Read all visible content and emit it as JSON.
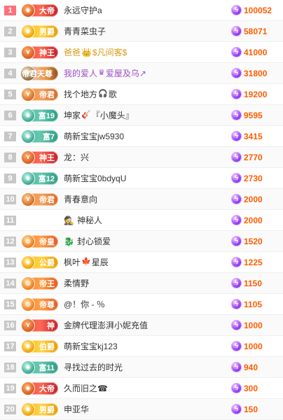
{
  "ranking": {
    "rows": [
      {
        "rank": "1",
        "badge_type": "dadi",
        "badge_label": "大帝",
        "badge_icon": "◉",
        "name": "永远守护a",
        "name_suffix": "",
        "score": "100052"
      },
      {
        "rank": "2",
        "badge_type": "nanjue",
        "badge_label": "男爵",
        "badge_icon": "◉",
        "name": "青青菜虫子",
        "name_suffix": "",
        "score": "58071"
      },
      {
        "rank": "3",
        "badge_type": "shenwang",
        "badge_label": "神王",
        "badge_icon": "⋎",
        "name": "爸爸",
        "name_suffix": "$凡间客$",
        "name_prefix_icon": "👑",
        "score": "41000"
      },
      {
        "rank": "4",
        "badge_type": "dijuntianzun",
        "badge_label": "帝君天尊",
        "badge_icon": "⋎",
        "name": "我的爱人",
        "name_suffix": "爱屋及乌↗",
        "name_prefix_icon": "♛",
        "score": "31800"
      },
      {
        "rank": "5",
        "badge_type": "dijun",
        "badge_label": "帝君",
        "badge_icon": "⋎",
        "name": "找个地方",
        "name_suffix": "歌",
        "name_prefix_icon": "🎧",
        "score": "19200"
      },
      {
        "rank": "6",
        "badge_type": "fu",
        "badge_label": "富19",
        "badge_icon": "◉",
        "name": "坤家",
        "name_suffix": "『小魔头』",
        "name_prefix_icon": "🎸",
        "score": "9595"
      },
      {
        "rank": "7",
        "badge_type": "fu",
        "badge_label": "富7",
        "badge_icon": "◉",
        "name": "萌新宝宝jw5930",
        "name_suffix": "",
        "score": "3415"
      },
      {
        "rank": "8",
        "badge_type": "shenwang",
        "badge_label": "神王",
        "badge_icon": "⋎",
        "name": "龙：兴",
        "name_suffix": "",
        "score": "2770"
      },
      {
        "rank": "9",
        "badge_type": "fu",
        "badge_label": "富12",
        "badge_icon": "◉",
        "name": "萌新宝宝0bdyqU",
        "name_suffix": "",
        "score": "2730"
      },
      {
        "rank": "10",
        "badge_type": "dijun",
        "badge_label": "帝君",
        "badge_icon": "⋎",
        "name": "青春意向",
        "name_suffix": "",
        "score": "2000"
      },
      {
        "rank": "11",
        "badge_type": "",
        "badge_label": "",
        "badge_icon": "",
        "name": "神秘人",
        "name_suffix": "",
        "name_prefix_icon": "🕵",
        "score": "2000"
      },
      {
        "rank": "12",
        "badge_type": "dihuang",
        "badge_label": "帝皇",
        "badge_icon": "◍",
        "name": "封心",
        "name_suffix": "锁爱",
        "name_prefix_icon": "🐉",
        "score": "1520"
      },
      {
        "rank": "13",
        "badge_type": "gongjue",
        "badge_label": "公爵",
        "badge_icon": "◉",
        "name": "枫叶",
        "name_suffix": "星辰",
        "name_prefix_icon": "🍁",
        "score": "1225"
      },
      {
        "rank": "14",
        "badge_type": "dizhi",
        "badge_label": "帝王",
        "badge_icon": "◍",
        "name": "柔情野",
        "name_suffix": "",
        "score": "1150"
      },
      {
        "rank": "15",
        "badge_type": "dizun",
        "badge_label": "帝尊",
        "badge_icon": "◍",
        "name": "@！你 - ％",
        "name_suffix": "",
        "score": "1105"
      },
      {
        "rank": "16",
        "badge_type": "shen",
        "badge_label": "神",
        "badge_icon": "⋎",
        "name": "金牌代理澎湃小妮充值",
        "name_suffix": "",
        "score": "1000"
      },
      {
        "rank": "17",
        "badge_type": "bojue",
        "badge_label": "伯爵",
        "badge_icon": "◉",
        "name": "萌新宝宝kj123",
        "name_suffix": "",
        "score": "1000"
      },
      {
        "rank": "18",
        "badge_type": "fu",
        "badge_label": "富11",
        "badge_icon": "◉",
        "name": "寻找过去的时光",
        "name_suffix": "",
        "score": "940"
      },
      {
        "rank": "19",
        "badge_type": "dadi",
        "badge_label": "大帝",
        "badge_icon": "◉",
        "name": "久而旧之",
        "name_suffix": "☎",
        "score": "300"
      },
      {
        "rank": "20",
        "badge_type": "nanjue",
        "badge_label": "男爵",
        "badge_icon": "◉",
        "name": "申亚华",
        "name_suffix": "",
        "score": "150"
      }
    ]
  },
  "score_icon_name": "purple-lightning-gem-icon",
  "colors": {
    "rank_top": "#ff6f7c",
    "rank_normal": "#c7c7c7",
    "score": "#ff5c00",
    "text": "#333333",
    "special_name": "#a050c8"
  }
}
